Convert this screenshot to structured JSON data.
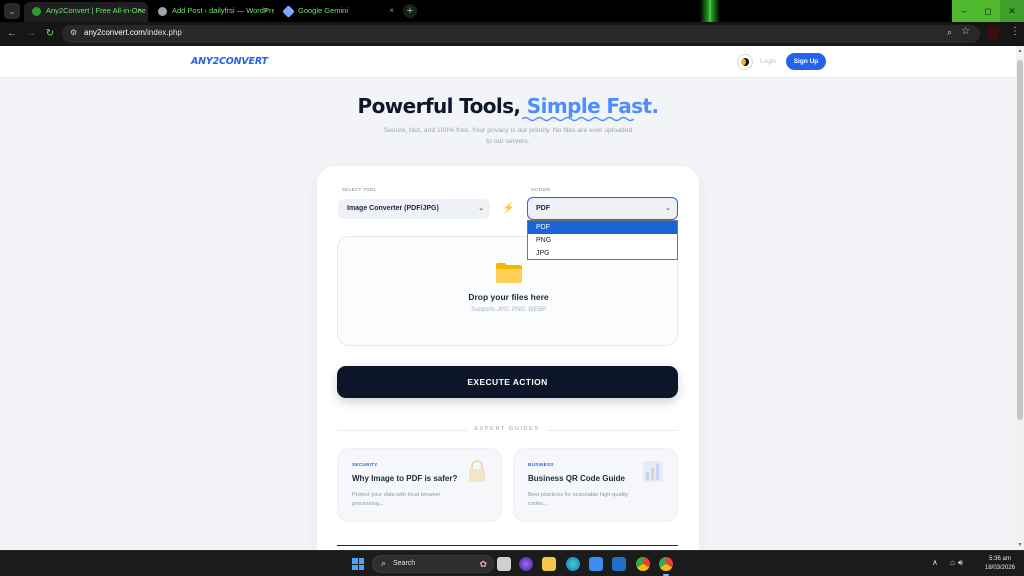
{
  "browser": {
    "tabs": [
      {
        "title": "Any2Convert | Free All-in-One",
        "active": true
      },
      {
        "title": "Add Post ‹ dailyfrsi — WordPress",
        "active": false
      },
      {
        "title": "Google Gemini",
        "active": false
      }
    ],
    "new_tab": "+",
    "address": {
      "host": "any2convert.com",
      "path": "/index.php"
    },
    "window_buttons": [
      "–",
      "◻",
      "✕"
    ]
  },
  "site": {
    "logo": "ANY2CONVERT",
    "login_label": "Login",
    "signup_label": "Sign Up"
  },
  "hero": {
    "title_plain": "Powerful Tools, ",
    "title_accent": "Simple Fast.",
    "subtitle": "Secure, fast, and 100% free. Your privacy is our priority. No files are ever uploaded to our servers."
  },
  "converter": {
    "tool_label": "SELECT TOOL",
    "tool_value": "Image Converter (PDF/JPG)",
    "action_label": "ACTION",
    "action_value": "PDF",
    "action_options": [
      "PDF",
      "PNG",
      "JPG"
    ],
    "drop_title": "Drop your files here",
    "drop_subtitle": "Supports JPG, PNG, WEBP",
    "execute_label": "EXECUTE ACTION"
  },
  "guides": {
    "heading": "EXPERT GUIDES",
    "items": [
      {
        "tag": "SECURITY",
        "title": "Why Image to PDF is safer?",
        "desc": "Protect your data with local browser processing..."
      },
      {
        "tag": "BUSINESS",
        "title": "Business QR Code Guide",
        "desc": "Best practices for scannable high-quality codes..."
      }
    ]
  },
  "taskbar": {
    "search_placeholder": "Search",
    "time": "5:36 am",
    "date": "18/03/2026"
  },
  "colors": {
    "brand": "#2563eb",
    "accent": "#4c8dff",
    "execute_bg": "#0b1628",
    "bolt": "#f97316"
  }
}
